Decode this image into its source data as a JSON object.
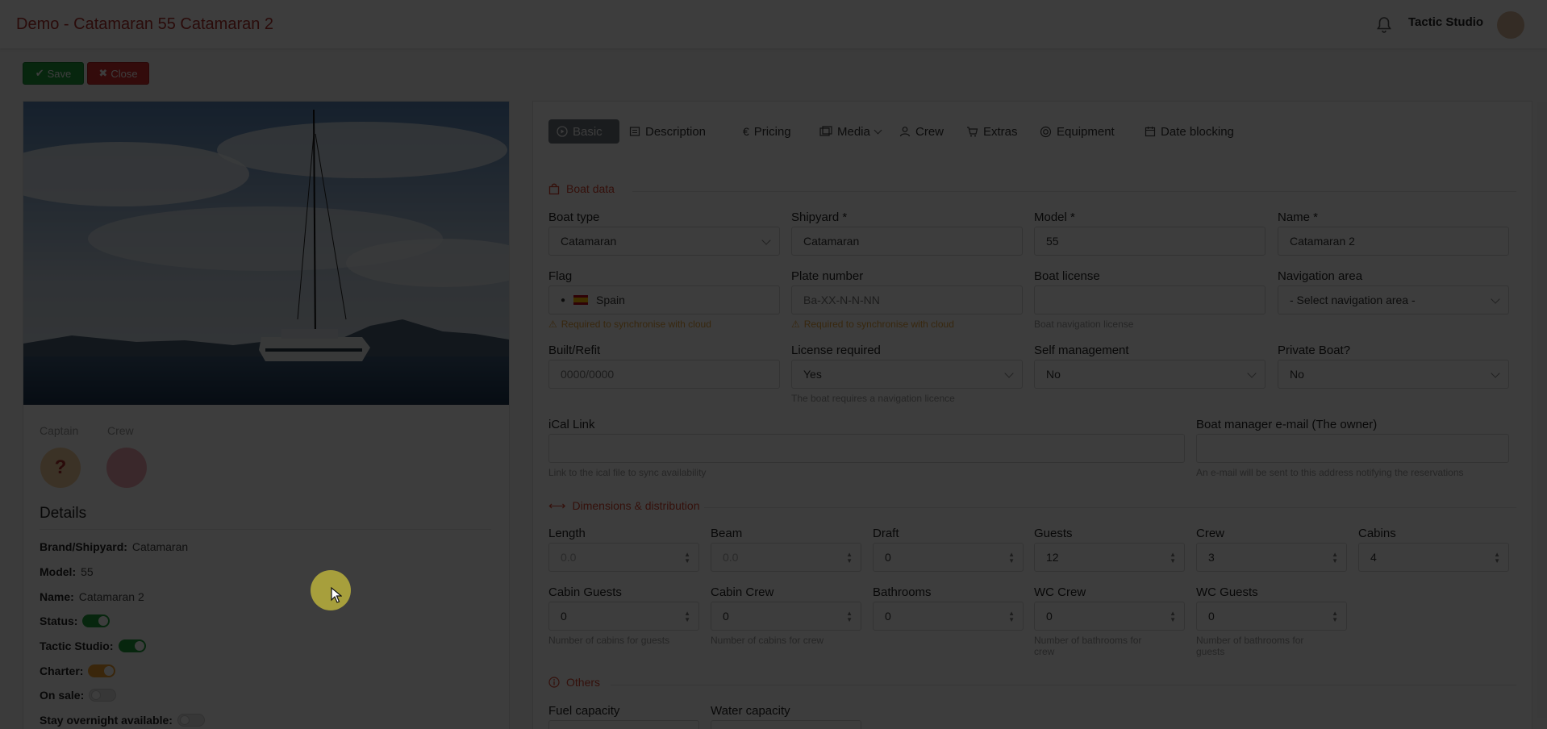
{
  "header": {
    "title": "Demo - Catamaran 55 Catamaran 2",
    "user_name": "Tactic Studio"
  },
  "actions": {
    "save_label": "Save",
    "close_label": "Close"
  },
  "people": {
    "captain_label": "Captain",
    "crew_label": "Crew",
    "captain_avatar": "?"
  },
  "details": {
    "title": "Details",
    "brand_label": "Brand/Shipyard:",
    "brand_value": "Catamaran",
    "model_label": "Model:",
    "model_value": "55",
    "name_label": "Name:",
    "name_value": "Catamaran 2",
    "status_label": "Status:",
    "status_on": true,
    "tactic_label": "Tactic Studio:",
    "tactic_on": true,
    "charter_label": "Charter:",
    "charter_on": true,
    "sale_label": "On sale:",
    "sale_on": false,
    "overnight_label": "Stay overnight available:",
    "overnight_on": false
  },
  "tabs": [
    {
      "label": "Basic",
      "icon": "play-circle-icon"
    },
    {
      "label": "Description",
      "icon": "document-icon"
    },
    {
      "label": "Pricing",
      "icon": "euro-icon"
    },
    {
      "label": "Media",
      "icon": "images-icon"
    },
    {
      "label": "Crew",
      "icon": "person-icon"
    },
    {
      "label": "Extras",
      "icon": "cart-icon"
    },
    {
      "label": "Equipment",
      "icon": "life-ring-icon"
    },
    {
      "label": "Date blocking",
      "icon": "calendar-icon"
    }
  ],
  "sections": {
    "boat_data": "Boat data",
    "dimensions": "Dimensions & distribution",
    "others": "Others"
  },
  "form": {
    "boat_type": {
      "label": "Boat type",
      "value": "Catamaran"
    },
    "shipyard": {
      "label": "Shipyard *",
      "value": "Catamaran"
    },
    "model": {
      "label": "Model *",
      "value": "55"
    },
    "name": {
      "label": "Name *",
      "value": "Catamaran 2"
    },
    "flag": {
      "label": "Flag",
      "value": "Spain",
      "warning": "Required to synchronise with cloud"
    },
    "plate": {
      "label": "Plate number",
      "placeholder": "Ba-XX-N-N-NN",
      "warning": "Required to synchronise with cloud"
    },
    "license": {
      "label": "Boat license",
      "hint": "Boat navigation license"
    },
    "nav_area": {
      "label": "Navigation area",
      "value": "- Select navigation area -"
    },
    "built": {
      "label": "Built/Refit",
      "placeholder": "0000/0000"
    },
    "license_required": {
      "label": "License required",
      "value": "Yes",
      "hint": "The boat requires a navigation licence"
    },
    "self_management": {
      "label": "Self management",
      "value": "No"
    },
    "private": {
      "label": "Private Boat?",
      "value": "No"
    },
    "ical": {
      "label": "iCal Link",
      "hint": "Link to the ical file to sync availability"
    },
    "manager_email": {
      "label": "Boat manager e-mail (The owner)",
      "hint": "An e-mail will be sent to this address notifying the reservations"
    },
    "length": {
      "label": "Length",
      "value": "0.0"
    },
    "beam": {
      "label": "Beam",
      "value": "0.0"
    },
    "draft": {
      "label": "Draft",
      "value": "0"
    },
    "guests": {
      "label": "Guests",
      "value": "12"
    },
    "crew": {
      "label": "Crew",
      "value": "3"
    },
    "cabins": {
      "label": "Cabins",
      "value": "4"
    },
    "cabin_guests": {
      "label": "Cabin Guests",
      "value": "0",
      "hint": "Number of cabins for guests"
    },
    "cabin_crew": {
      "label": "Cabin Crew",
      "value": "0",
      "hint": "Number of cabins for crew"
    },
    "bathrooms": {
      "label": "Bathrooms",
      "value": "0"
    },
    "wc_crew": {
      "label": "WC Crew",
      "value": "0",
      "hint1": "Number of bathrooms for",
      "hint2": "crew"
    },
    "wc_guests": {
      "label": "WC Guests",
      "value": "0",
      "hint1": "Number of bathrooms for",
      "hint2": "guests"
    },
    "fuel": {
      "label": "Fuel capacity"
    },
    "water": {
      "label": "Water capacity"
    }
  },
  "colors": {
    "title_red": "#b0302c",
    "save_green": "#1e9e3c",
    "close_red": "#d62f2f",
    "section_orange": "#d9452f",
    "toggle_green": "#1e9e3c",
    "toggle_orange": "#f0a030",
    "warning": "#e6a23c"
  }
}
